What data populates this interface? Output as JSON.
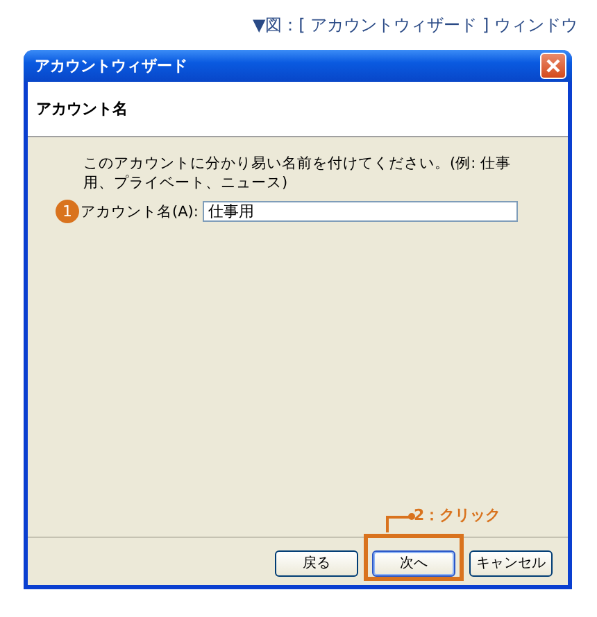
{
  "caption": "▼図：[ アカウントウィザード ] ウィンドウ",
  "window": {
    "title": "アカウントウィザード"
  },
  "header": {
    "title": "アカウント名"
  },
  "description": "このアカウントに分かり易い名前を付けてください。(例: 仕事用、プライベート、ニュース)",
  "field": {
    "step": "1",
    "label": "アカウント名(A):",
    "value": "仕事用"
  },
  "buttons": [
    {
      "label": "戻る",
      "highlighted": false
    },
    {
      "label": "次へ",
      "highlighted": true
    },
    {
      "label": "キャンセル",
      "highlighted": false
    }
  ],
  "callout": "2：クリック"
}
